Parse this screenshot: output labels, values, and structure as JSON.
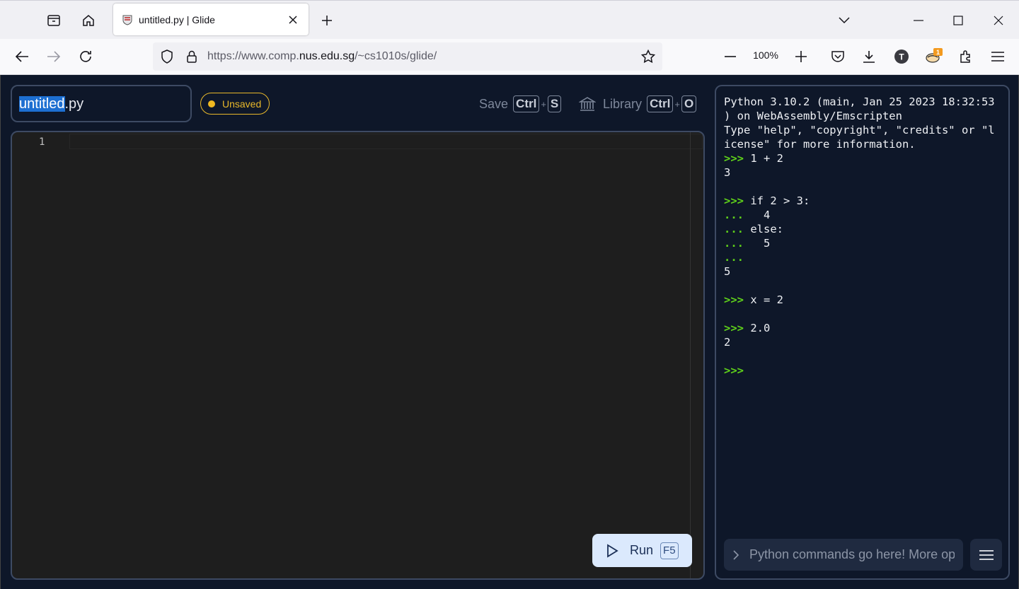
{
  "tab": {
    "title": "untitled.py | Glide"
  },
  "urlbar": {
    "prefix": "https://www.comp.",
    "domain": "nus.edu.sg",
    "path": "/~cs1010s/glide/"
  },
  "toolbar": {
    "zoom": "100%",
    "extension_badge": "1"
  },
  "app": {
    "filename_selected": "untitled",
    "filename_ext": ".py",
    "status_badge": "Unsaved",
    "save_label": "Save",
    "save_key1": "Ctrl",
    "save_key2": "S",
    "library_label": "Library",
    "library_key1": "Ctrl",
    "library_key2": "O",
    "plus": "+"
  },
  "editor": {
    "line_number": "1",
    "run_label": "Run",
    "run_key": "F5"
  },
  "console": {
    "banner_1": "Python 3.10.2 (main, Jan 25 2023 18:32:53",
    "banner_2": ") on WebAssembly/Emscripten",
    "banner_3": "Type \"help\", \"copyright\", \"credits\" or \"l",
    "banner_4": "icense\" for more information.",
    "prompt": ">>>",
    "continuation": "...",
    "line_1_in": "1 + 2",
    "line_1_out": "3",
    "line_2_in": "if 2 > 3:",
    "line_2_c1": "  4",
    "line_2_c2": "else:",
    "line_2_c3": "  5",
    "line_2_out": "5",
    "line_3_in": "x = 2",
    "line_4_in": "2.0",
    "line_4_out": "2",
    "input_placeholder": "Python commands go here! More op"
  },
  "colors": {
    "accent": "#1d6fd1",
    "prompt_green": "#5fd11a",
    "unsaved_amber": "#e8b82a",
    "run_bg": "#dbe9fd"
  }
}
